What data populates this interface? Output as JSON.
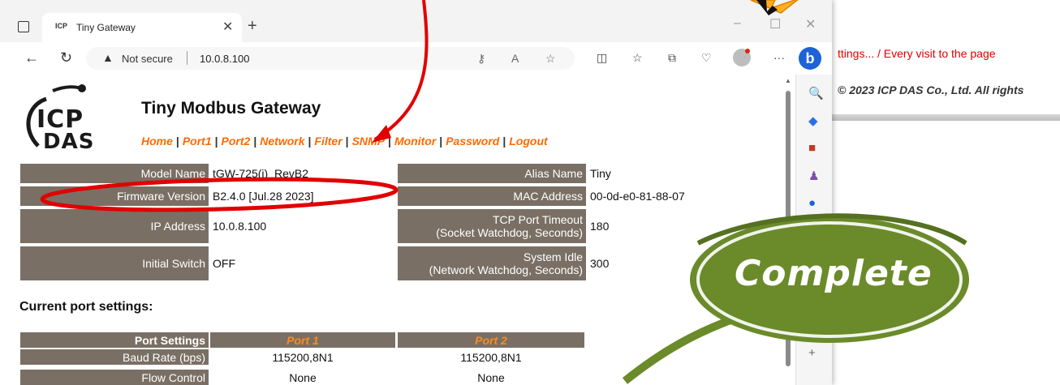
{
  "browser": {
    "tab_title": "Tiny Gateway",
    "favicon_text": "ICP",
    "not_secure": "Not secure",
    "url": "10.0.8.100",
    "window_controls": [
      "–",
      "☐",
      "✕"
    ]
  },
  "background_page": {
    "line1": "ttings... / Every visit to the page",
    "line2": "© 2023 ICP DAS Co., Ltd. All rights"
  },
  "logo": {
    "top": "ICP",
    "bottom": "DAS"
  },
  "page": {
    "title": "Tiny Modbus Gateway",
    "nav": [
      "Home",
      "Port1",
      "Port2",
      "Network",
      "Filter",
      "SNMP",
      "Monitor",
      "Password",
      "Logout"
    ]
  },
  "info": {
    "model_name_label": "Model Name",
    "model_name_value": "tGW-725(i)_RevB2",
    "firmware_label": "Firmware Version",
    "firmware_value": "B2.4.0 [Jul.28 2023]",
    "ip_label": "IP Address",
    "ip_value": "10.0.8.100",
    "switch_label": "Initial Switch",
    "switch_value": "OFF",
    "alias_label": "Alias Name",
    "alias_value": "Tiny",
    "mac_label": "MAC Address",
    "mac_value": "00-0d-e0-81-88-07",
    "tcp_label_1": "TCP Port Timeout",
    "tcp_label_2": "(Socket Watchdog, Seconds)",
    "tcp_value": "180",
    "idle_label_1": "System Idle",
    "idle_label_2": "(Network Watchdog, Seconds)",
    "idle_value": "300"
  },
  "port_settings": {
    "section_title": "Current port settings:",
    "header_label": "Port Settings",
    "port1": "Port 1",
    "port2": "Port 2",
    "rows": [
      {
        "label": "Baud Rate (bps)",
        "port1": "115200,8N1",
        "port2": "115200,8N1"
      },
      {
        "label": "Flow Control",
        "port1": "None",
        "port2": "None"
      }
    ]
  },
  "overlay": {
    "complete": "Complete"
  },
  "colors": {
    "label_bg": "#7a6f64",
    "nav_link": "#ff6a00",
    "ellipse": "#e00000",
    "badge": "#6b8a2a"
  }
}
